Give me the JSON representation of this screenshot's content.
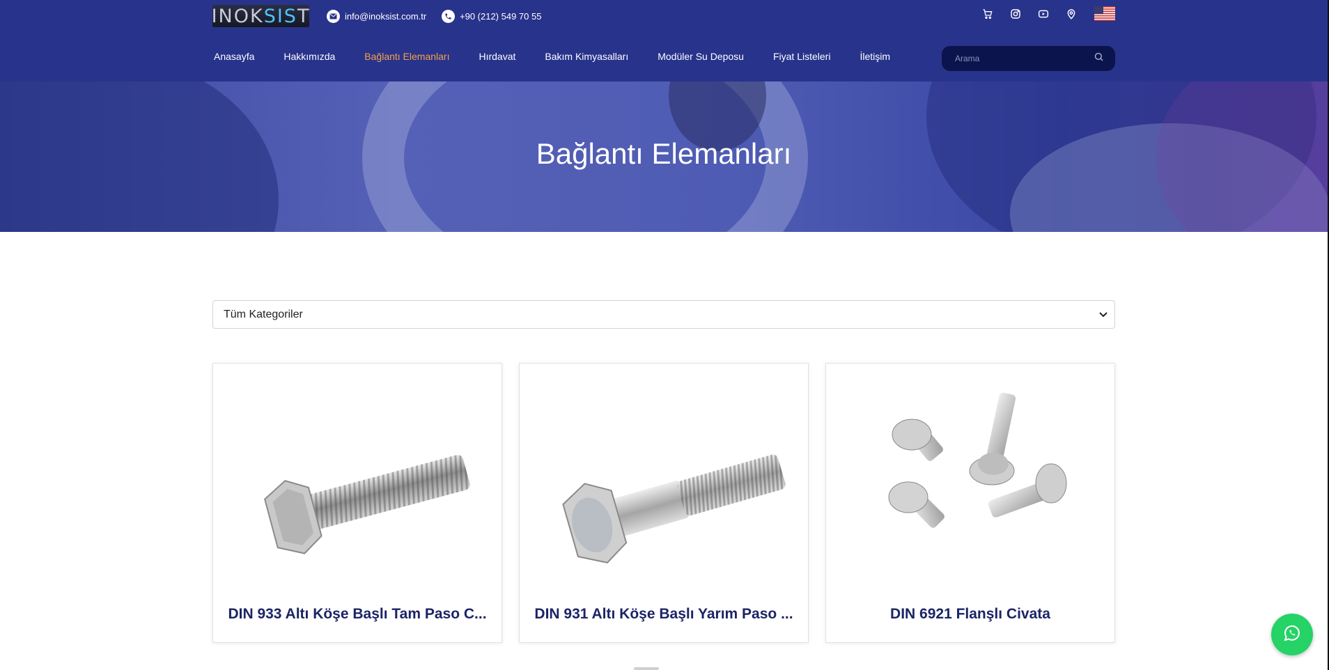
{
  "header": {
    "logo": {
      "part1": "INOK",
      "part2": "SIS",
      "part3": "T"
    },
    "email": "info@inoksist.com.tr",
    "phone": "+90 (212) 549 70 55",
    "icons": [
      "cart-icon",
      "instagram-icon",
      "youtube-icon",
      "location-icon"
    ],
    "language_flag": "us-flag-icon"
  },
  "nav": {
    "items": [
      {
        "label": "Anasayfa",
        "active": false
      },
      {
        "label": "Hakkımızda",
        "active": false
      },
      {
        "label": "Bağlantı Elemanları",
        "active": true
      },
      {
        "label": "Hırdavat",
        "active": false
      },
      {
        "label": "Bakım Kimyasalları",
        "active": false
      },
      {
        "label": "Modüler Su Deposu",
        "active": false
      },
      {
        "label": "Fiyat Listeleri",
        "active": false
      },
      {
        "label": "İletişim",
        "active": false
      }
    ],
    "search_placeholder": "Arama"
  },
  "hero": {
    "title": "Bağlantı Elemanları"
  },
  "filter": {
    "selected": "Tüm Kategoriler"
  },
  "products": [
    {
      "title": "DIN 933 Altı Köşe Başlı Tam Paso C..."
    },
    {
      "title": "DIN 931 Altı Köşe Başlı Yarım Paso ..."
    },
    {
      "title": "DIN 6921 Flanşlı Civata"
    }
  ],
  "colors": {
    "header_bg": "#28338c",
    "nav_active": "#f6a14a",
    "product_title": "#1b2466",
    "whatsapp": "#25d366"
  }
}
